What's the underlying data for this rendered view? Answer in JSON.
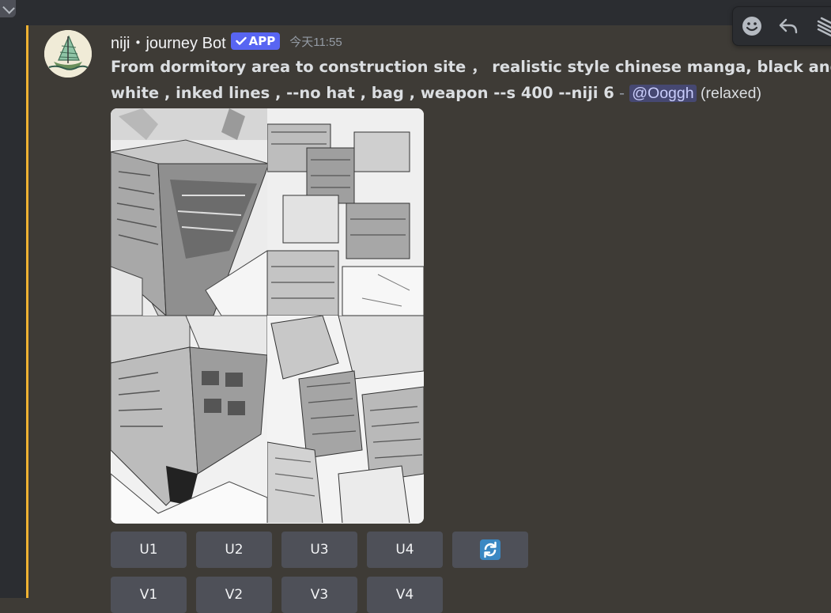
{
  "message": {
    "author": "niji・journey Bot",
    "badge": "APP",
    "timestamp": "今天11:55",
    "content_line1": "From dormitory area to construction site ，  realistic style chinese manga, black and",
    "content_line2": "white , inked lines , --no hat , bag , weapon --s 400 --niji 6",
    "separator": " - ",
    "mention": "@Ooggh",
    "suffix": " (relaxed)"
  },
  "toolbar": {
    "icons": [
      "emoji-icon",
      "reply-icon",
      "more-icon"
    ]
  },
  "buttons": {
    "row1": [
      "U1",
      "U2",
      "U3",
      "U4"
    ],
    "reroll_icon": "refresh-icon",
    "row2": [
      "V1",
      "V2",
      "V3",
      "V4"
    ]
  },
  "colors": {
    "background": "#3e3b36",
    "highlight": "#f0b232",
    "badge": "#5865f2",
    "button": "#4e5058",
    "reroll": "#3b88c3"
  }
}
